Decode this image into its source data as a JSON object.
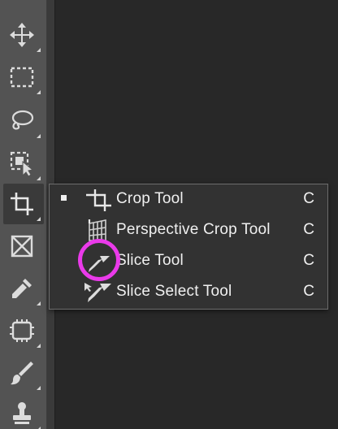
{
  "toolbar": {
    "tools": [
      {
        "name": "move-tool",
        "icon": "move-icon"
      },
      {
        "name": "rectangular-marquee-tool",
        "icon": "marquee-icon"
      },
      {
        "name": "lasso-tool",
        "icon": "lasso-icon"
      },
      {
        "name": "object-selection-tool",
        "icon": "object-selection-icon"
      },
      {
        "name": "crop-tool",
        "icon": "crop-icon",
        "active": true
      },
      {
        "name": "frame-tool",
        "icon": "frame-icon"
      },
      {
        "name": "eyedropper-tool",
        "icon": "eyedropper-icon"
      },
      {
        "name": "spot-healing-tool",
        "icon": "bandage-icon"
      },
      {
        "name": "brush-tool",
        "icon": "brush-icon"
      },
      {
        "name": "clone-stamp-tool",
        "icon": "stamp-icon"
      }
    ]
  },
  "flyout_menu": {
    "items": [
      {
        "label": "Crop Tool",
        "shortcut": "C",
        "icon": "crop-icon",
        "selected": true
      },
      {
        "label": "Perspective Crop Tool",
        "shortcut": "C",
        "icon": "perspective-crop-icon",
        "selected": false
      },
      {
        "label": "Slice Tool",
        "shortcut": "C",
        "icon": "slice-icon",
        "selected": false
      },
      {
        "label": "Slice Select Tool",
        "shortcut": "C",
        "icon": "slice-select-icon",
        "selected": false
      }
    ]
  },
  "colors": {
    "toolbar_bg": "#535353",
    "canvas_bg": "#282828",
    "menu_bg": "#323232",
    "menu_text": "#f0f0f0",
    "highlight_circle": "#ea3aea"
  }
}
